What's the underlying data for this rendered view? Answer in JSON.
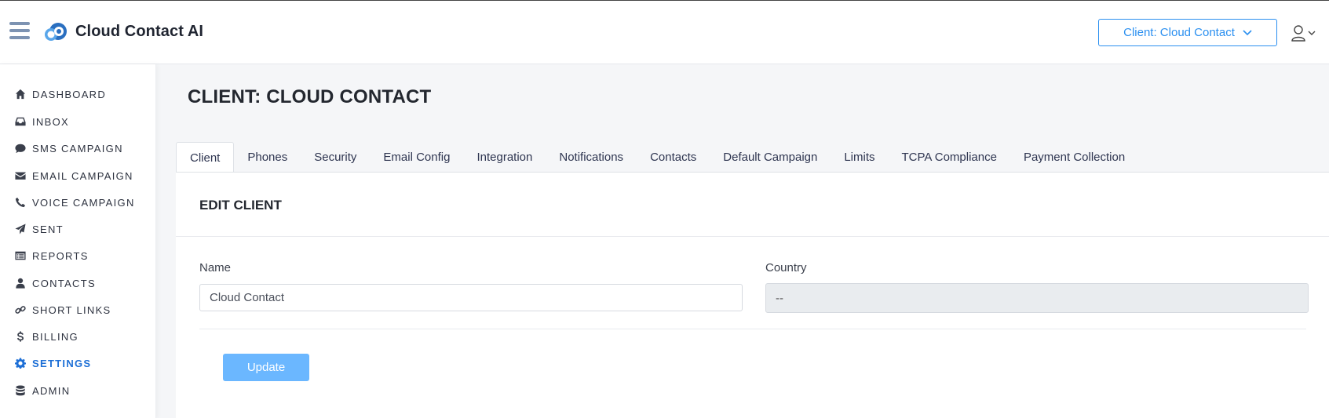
{
  "header": {
    "brand": "Cloud Contact AI",
    "client_select_label": "Client: Cloud Contact"
  },
  "sidebar": {
    "items": [
      {
        "label": "DASHBOARD",
        "icon": "home-icon"
      },
      {
        "label": "INBOX",
        "icon": "inbox-icon"
      },
      {
        "label": "SMS CAMPAIGN",
        "icon": "comment-icon"
      },
      {
        "label": "EMAIL CAMPAIGN",
        "icon": "envelope-icon"
      },
      {
        "label": "VOICE CAMPAIGN",
        "icon": "phone-icon"
      },
      {
        "label": "SENT",
        "icon": "paper-plane-icon"
      },
      {
        "label": "REPORTS",
        "icon": "list-alt-icon"
      },
      {
        "label": "CONTACTS",
        "icon": "user-icon"
      },
      {
        "label": "SHORT LINKS",
        "icon": "link-icon"
      },
      {
        "label": "BILLING",
        "icon": "dollar-icon"
      },
      {
        "label": "SETTINGS",
        "icon": "gear-icon",
        "active": true
      },
      {
        "label": "ADMIN",
        "icon": "database-icon"
      }
    ]
  },
  "main": {
    "page_title": "CLIENT: CLOUD CONTACT",
    "tabs": [
      {
        "label": "Client",
        "active": true
      },
      {
        "label": "Phones"
      },
      {
        "label": "Security"
      },
      {
        "label": "Email Config"
      },
      {
        "label": "Integration"
      },
      {
        "label": "Notifications"
      },
      {
        "label": "Contacts"
      },
      {
        "label": "Default Campaign"
      },
      {
        "label": "Limits"
      },
      {
        "label": "TCPA Compliance"
      },
      {
        "label": "Payment Collection"
      }
    ],
    "card": {
      "title": "EDIT CLIENT",
      "name_label": "Name",
      "name_value": "Cloud Contact",
      "country_label": "Country",
      "country_value": "--",
      "update_label": "Update"
    }
  },
  "colors": {
    "accent": "#2a8ff0",
    "active_nav": "#1d6fd6",
    "update_button": "#6bb7ff"
  }
}
